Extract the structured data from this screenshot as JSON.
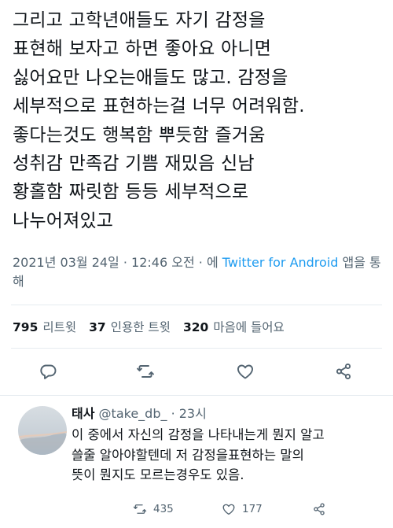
{
  "tweet": {
    "lines": [
      "그리고 고학년애들도 자기 감정을",
      "표현해 보자고 하면 좋아요 아니면",
      "싫어요만 나오는애들도 많고. 감정을",
      "세부적으로 표현하는걸 너무 어려워함.",
      "좋다는것도 행복함 뿌듯함 즐거움",
      "성취감 만족감 기쁨 재밌음 신남",
      "황홀함 짜릿함 등등 세부적으로",
      "나누어져있고"
    ],
    "meta": {
      "date": "2021년 03월 24일",
      "sep1": " · ",
      "time": "12:46 오전",
      "sep2": " · ",
      "via": "에 ",
      "source": "Twitter for Android",
      "suffix": " 앱을 통해"
    },
    "stats": {
      "retweets_count": "795",
      "retweets_label": "리트윗",
      "quotes_count": "37",
      "quotes_label": "인용한 트윗",
      "likes_count": "320",
      "likes_label": "마음에 들어요"
    },
    "actions": {
      "reply_icon": "reply-icon",
      "retweet_icon": "retweet-icon",
      "like_icon": "heart-icon",
      "share_icon": "share-icon"
    }
  },
  "reply": {
    "name": "태사",
    "handle": "@take_db_",
    "dot": " · ",
    "time": "23시",
    "lines": [
      "이 중에서 자신의 감정을 나타내는게 뭔지 알고",
      "쓸줄 알아야할텐데 저 감정을표현하는 말의",
      "뜻이 뭔지도 모르는경우도 있음."
    ],
    "retweets": "435",
    "likes": "177"
  },
  "colors": {
    "text": "#0f1419",
    "secondary": "#536471",
    "link": "#1d9bf0",
    "divider": "#e6ecf0"
  }
}
